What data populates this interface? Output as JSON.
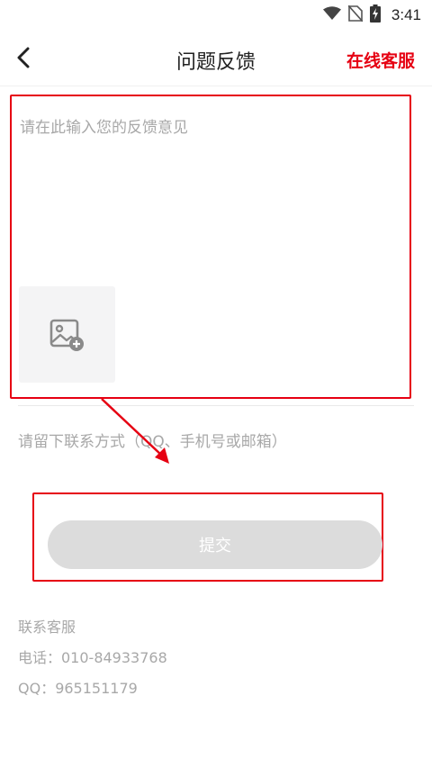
{
  "status_bar": {
    "time": "3:41",
    "icons": [
      "wifi-icon",
      "no-sim-icon",
      "battery-charging-icon"
    ]
  },
  "header": {
    "title": "问题反馈",
    "online_service": "在线客服",
    "back_icon": "chevron-left-icon"
  },
  "feedback": {
    "placeholder": "请在此输入您的反馈意见",
    "image_upload_icon": "add-image-icon"
  },
  "contact_field": {
    "placeholder": "请留下联系方式（QQ、手机号或邮箱）"
  },
  "submit": {
    "label": "提交"
  },
  "contact_info": {
    "title": "联系客服",
    "phone": "电话：010-84933768",
    "qq": "QQ：965151179"
  },
  "colors": {
    "accent": "#e60012",
    "placeholder": "#a8a8a8",
    "button_disabled": "#dcdcdc"
  }
}
